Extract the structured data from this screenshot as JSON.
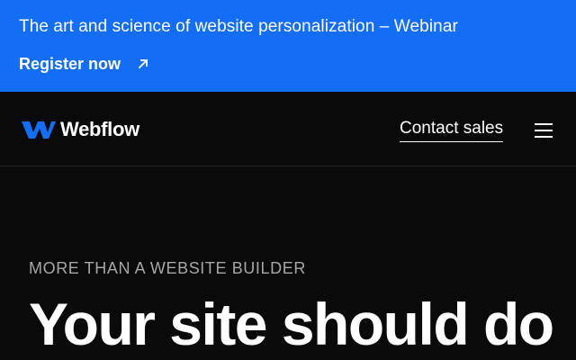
{
  "banner": {
    "text": "The art and science of website personalization – Webinar",
    "link_label": "Register now",
    "background": "#146ef5",
    "link_icon": "arrow-up-right-icon"
  },
  "nav": {
    "logo_text": "Webflow",
    "logo_icon": "webflow-logo-icon",
    "contact_label": "Contact sales",
    "menu_icon": "hamburger-menu-icon"
  },
  "hero": {
    "eyebrow": "MORE THAN A WEBSITE BUILDER",
    "title": "Your site should do"
  }
}
